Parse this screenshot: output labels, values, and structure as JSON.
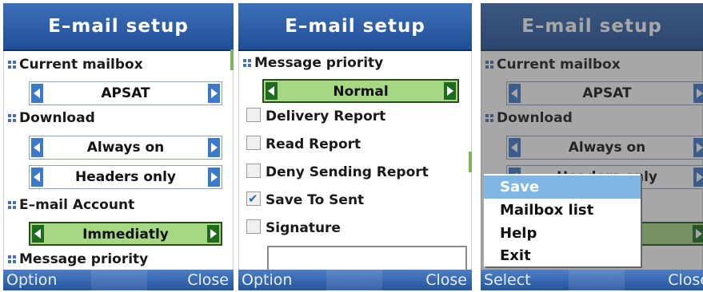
{
  "screen1": {
    "title": "E–mail setup",
    "current_mailbox_label": "Current mailbox",
    "current_mailbox_value": "APSAT",
    "download_label": "Download",
    "download_value": "Always on",
    "download_option_value": "Headers only",
    "email_account_label": "E–mail Account",
    "email_account_value": "Immediatly",
    "message_priority_label": "Message priority",
    "soft_left": "Option",
    "soft_right": "Close"
  },
  "screen2": {
    "title": "E–mail setup",
    "message_priority_label": "Message priority",
    "message_priority_value": "Normal",
    "checkboxes": [
      {
        "label": "Delivery Report",
        "checked": false
      },
      {
        "label": "Read Report",
        "checked": false
      },
      {
        "label": "Deny Sending Report",
        "checked": false
      },
      {
        "label": "Save To Sent",
        "checked": true
      },
      {
        "label": "Signature",
        "checked": false
      }
    ],
    "soft_left": "Option",
    "soft_right": "Close"
  },
  "screen3": {
    "title": "E–mail setup",
    "current_mailbox_label": "Current mailbox",
    "current_mailbox_value": "APSAT",
    "download_label": "Download",
    "download_value": "Always on",
    "download_option_partial": "Headers only",
    "menu": [
      "Save",
      "Mailbox list",
      "Help",
      "Exit"
    ],
    "selected_menu_index": 0,
    "soft_left": "Select",
    "soft_right": "Close"
  },
  "colors": {
    "title_bar": "#2a5aa6",
    "selector_active": "#a6d884",
    "arrow": "#3d79c9",
    "menu_highlight": "#7fb6e4"
  }
}
